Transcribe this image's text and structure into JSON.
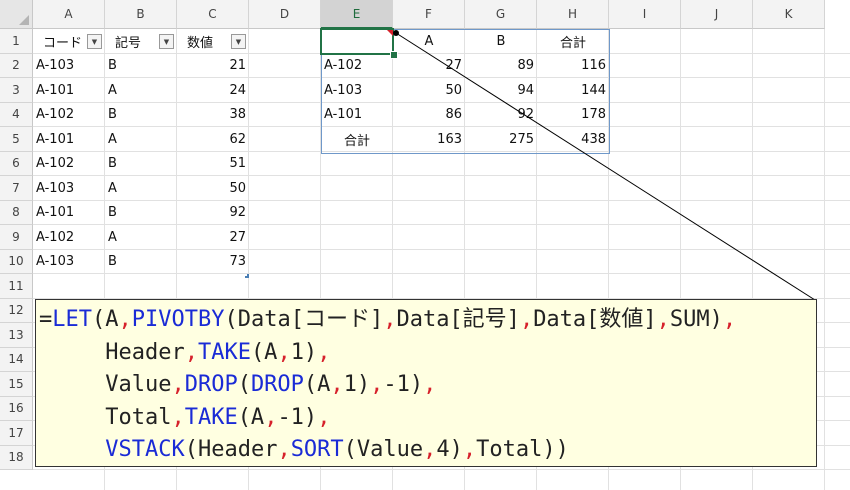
{
  "columns": [
    "A",
    "B",
    "C",
    "D",
    "E",
    "F",
    "G",
    "H",
    "I",
    "J",
    "K"
  ],
  "rows": [
    "1",
    "2",
    "3",
    "4",
    "5",
    "6",
    "7",
    "8",
    "9",
    "10",
    "11",
    "12",
    "13",
    "14",
    "15",
    "16",
    "17",
    "18"
  ],
  "selected_column": "E",
  "table": {
    "headers": [
      "コード",
      "記号",
      "数値"
    ],
    "rows": [
      [
        "A-103",
        "B",
        "21"
      ],
      [
        "A-101",
        "A",
        "24"
      ],
      [
        "A-102",
        "B",
        "38"
      ],
      [
        "A-101",
        "A",
        "62"
      ],
      [
        "A-102",
        "B",
        "51"
      ],
      [
        "A-103",
        "A",
        "50"
      ],
      [
        "A-101",
        "B",
        "92"
      ],
      [
        "A-102",
        "A",
        "27"
      ],
      [
        "A-103",
        "B",
        "73"
      ]
    ]
  },
  "pivot": {
    "header": [
      "",
      "A",
      "B",
      "合計"
    ],
    "rows": [
      [
        "A-102",
        "27",
        "89",
        "116"
      ],
      [
        "A-103",
        "50",
        "94",
        "144"
      ],
      [
        "A-101",
        "86",
        "92",
        "178"
      ]
    ],
    "total": [
      "合計",
      "163",
      "275",
      "438"
    ]
  },
  "formula_lines": [
    [
      {
        "t": "=",
        "k": "txt"
      },
      {
        "t": "LET",
        "k": "fn"
      },
      {
        "t": "(",
        "k": "txt"
      },
      {
        "t": "A",
        "k": "txt"
      },
      {
        "t": ",",
        "k": "sep"
      },
      {
        "t": "PIVOTBY",
        "k": "fn"
      },
      {
        "t": "(",
        "k": "txt"
      },
      {
        "t": "Data[コード]",
        "k": "txt"
      },
      {
        "t": ",",
        "k": "sep"
      },
      {
        "t": "Data[記号]",
        "k": "txt"
      },
      {
        "t": ",",
        "k": "sep"
      },
      {
        "t": "Data[数値]",
        "k": "txt"
      },
      {
        "t": ",",
        "k": "sep"
      },
      {
        "t": "SUM",
        "k": "txt"
      },
      {
        "t": ")",
        "k": "txt"
      },
      {
        "t": ",",
        "k": "sep"
      }
    ],
    [
      {
        "t": "     Header",
        "k": "txt"
      },
      {
        "t": ",",
        "k": "sep"
      },
      {
        "t": "TAKE",
        "k": "fn"
      },
      {
        "t": "(A",
        "k": "txt"
      },
      {
        "t": ",",
        "k": "sep"
      },
      {
        "t": "1)",
        "k": "txt"
      },
      {
        "t": ",",
        "k": "sep"
      }
    ],
    [
      {
        "t": "     Value",
        "k": "txt"
      },
      {
        "t": ",",
        "k": "sep"
      },
      {
        "t": "DROP",
        "k": "fn"
      },
      {
        "t": "(",
        "k": "txt"
      },
      {
        "t": "DROP",
        "k": "fn"
      },
      {
        "t": "(A",
        "k": "txt"
      },
      {
        "t": ",",
        "k": "sep"
      },
      {
        "t": "1)",
        "k": "txt"
      },
      {
        "t": ",",
        "k": "sep"
      },
      {
        "t": "-1)",
        "k": "txt"
      },
      {
        "t": ",",
        "k": "sep"
      }
    ],
    [
      {
        "t": "     Total",
        "k": "txt"
      },
      {
        "t": ",",
        "k": "sep"
      },
      {
        "t": "TAKE",
        "k": "fn"
      },
      {
        "t": "(A",
        "k": "txt"
      },
      {
        "t": ",",
        "k": "sep"
      },
      {
        "t": "-1)",
        "k": "txt"
      },
      {
        "t": ",",
        "k": "sep"
      }
    ],
    [
      {
        "t": "     ",
        "k": "txt"
      },
      {
        "t": "VSTACK",
        "k": "fn"
      },
      {
        "t": "(Header",
        "k": "txt"
      },
      {
        "t": ",",
        "k": "sep"
      },
      {
        "t": "SORT",
        "k": "fn"
      },
      {
        "t": "(Value",
        "k": "txt"
      },
      {
        "t": ",",
        "k": "sep"
      },
      {
        "t": "4)",
        "k": "txt"
      },
      {
        "t": ",",
        "k": "sep"
      },
      {
        "t": "Total))",
        "k": "txt"
      }
    ]
  ],
  "colors": {
    "selection": "#217346",
    "function": "#1a2bd6",
    "separator": "#d6212b",
    "note_bg": "#ffffe1"
  }
}
